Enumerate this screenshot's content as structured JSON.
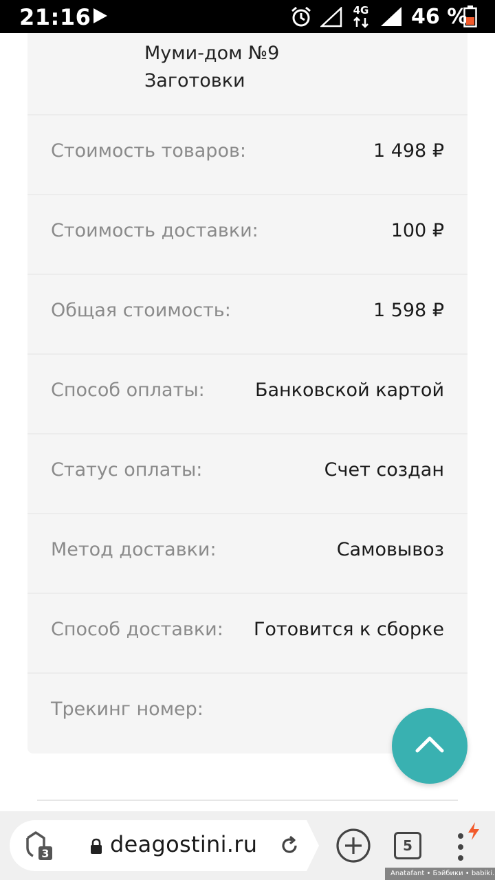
{
  "status_bar": {
    "time": "21:16",
    "network": "4G",
    "battery": "46 %"
  },
  "order": {
    "items": [
      "Муми-дом №9",
      "Заготовки"
    ],
    "rows": [
      {
        "label": "Стоимость товаров:",
        "value": "1 498 ₽"
      },
      {
        "label": "Стоимость доставки:",
        "value": "100 ₽"
      },
      {
        "label": "Общая стоимость:",
        "value": "1 598 ₽"
      },
      {
        "label": "Способ оплаты:",
        "value": "Банковской картой"
      },
      {
        "label": "Статус оплаты:",
        "value": "Счет создан"
      },
      {
        "label": "Метод доставки:",
        "value": "Самовывоз"
      },
      {
        "label": "Способ доставки:",
        "value": "Готовится к сборке"
      },
      {
        "label": "Трекинг номер:",
        "value": ""
      }
    ]
  },
  "browser": {
    "url": "deagostini.ru",
    "shield_count": "3",
    "tab_count": "5"
  },
  "colors": {
    "accent": "#39b1b1",
    "card_bg": "#f5f5f5",
    "label_text": "#8a8a8a",
    "value_text": "#1a1a1a",
    "bolt": "#f25a2b"
  },
  "icons": [
    "play-icon",
    "alarm-icon",
    "signal-icon",
    "battery-icon",
    "chevron-up-icon",
    "shield-icon",
    "lock-icon",
    "reload-icon",
    "add-tab-icon",
    "tabs-icon",
    "menu-dots-icon",
    "bolt-icon"
  ],
  "watermark": "Anatafant • Бэйбики • babiki.ru"
}
